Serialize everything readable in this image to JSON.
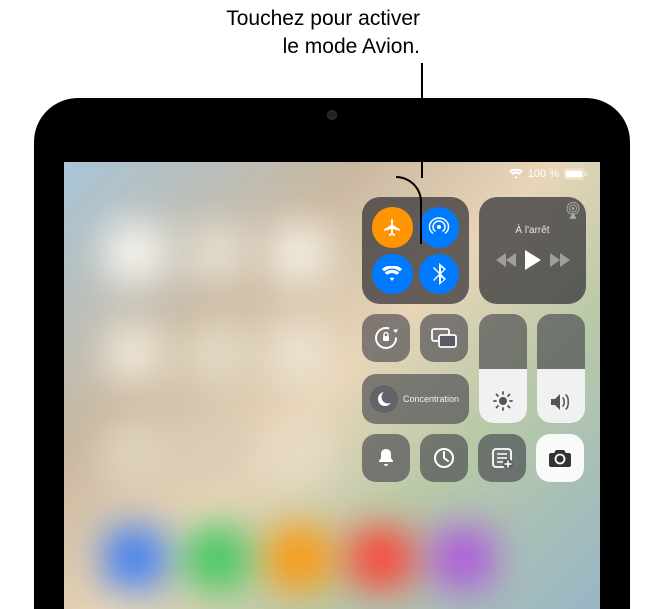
{
  "callout": {
    "line1": "Touchez pour activer",
    "line2": "le mode Avion."
  },
  "status": {
    "battery_pct": "100 %"
  },
  "connectivity": {
    "airplane": {
      "active": true
    },
    "airdrop": {
      "active": true
    },
    "wifi": {
      "active": true
    },
    "bluetooth": {
      "active": true
    }
  },
  "media": {
    "status_label": "À l'arrêt"
  },
  "focus": {
    "label": "Concentration"
  },
  "sliders": {
    "brightness_pct": 50,
    "volume_pct": 50
  },
  "colors": {
    "blue": "#007AFF",
    "orange": "#FF9500",
    "module_bg": "rgba(60, 60, 70, 0.6)"
  }
}
